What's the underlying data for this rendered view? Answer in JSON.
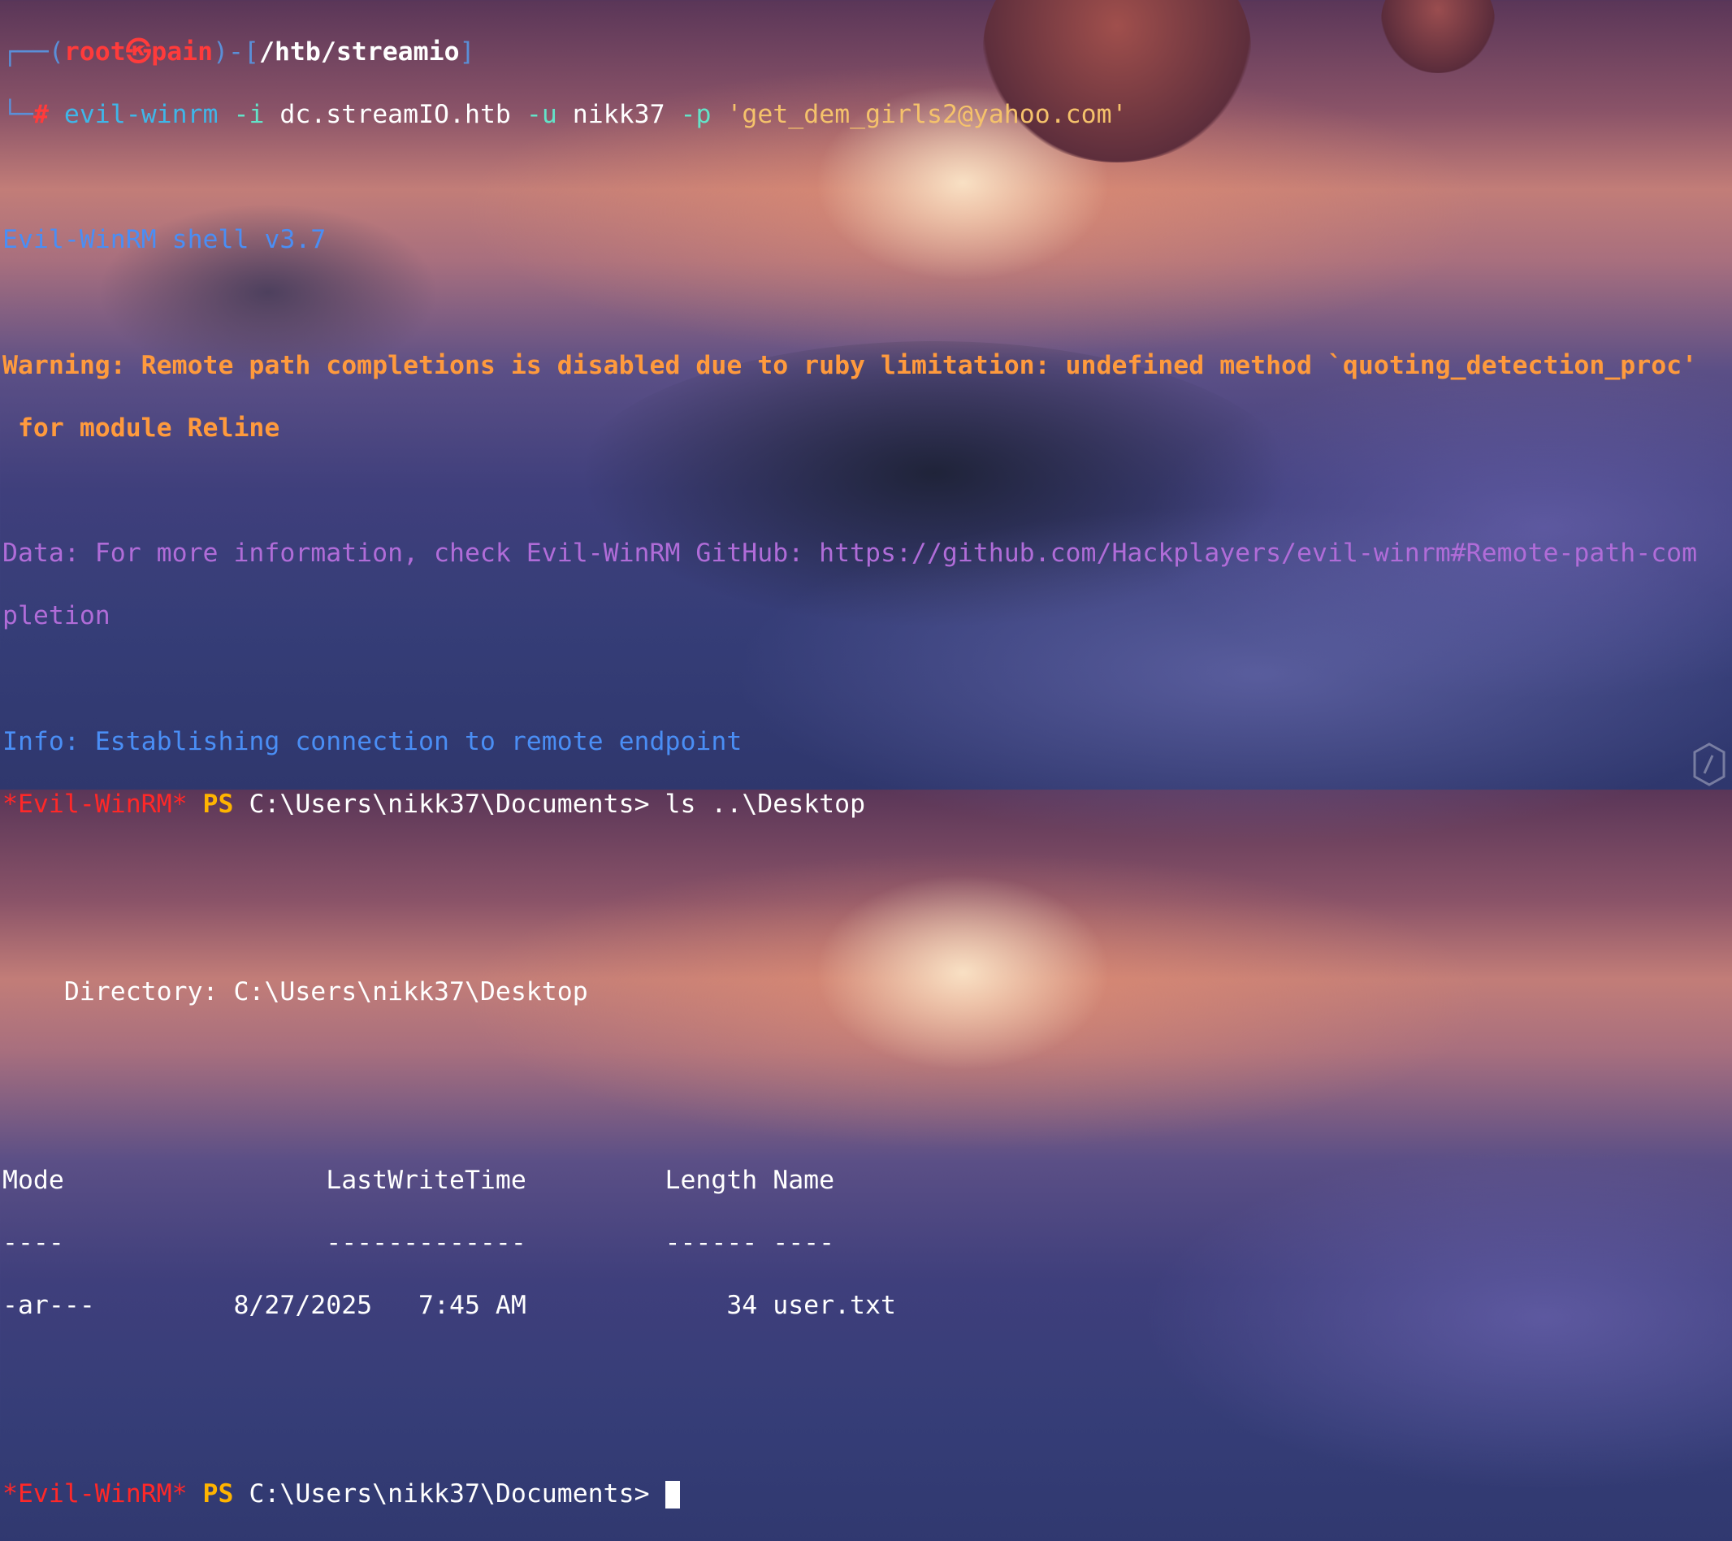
{
  "prompt1": {
    "corner_top": "┌──(",
    "user": "root",
    "at": "㉿",
    "host": "pain",
    "mid": ")-[",
    "path": "/htb/streamio",
    "end": "]",
    "corner_bottom": "└─",
    "hash": "#",
    "cmd": "evil-winrm",
    "flag_i": "-i",
    "host_arg": "dc.streamIO.htb",
    "flag_u": "-u",
    "user_arg": "nikk37",
    "flag_p": "-p",
    "pass_arg": "'get_dem_girls2@yahoo.com'"
  },
  "banner": "Evil-WinRM shell v3.7",
  "warning_line1": "Warning: Remote path completions is disabled due to ruby limitation: undefined method `quoting_detection_proc'",
  "warning_line2": " for module Reline",
  "data_line1": "Data: For more information, check Evil-WinRM GitHub: https://github.com/Hackplayers/evil-winrm#Remote-path-com",
  "data_line2": "pletion",
  "info_line": "Info: Establishing connection to remote endpoint",
  "ps_prompt": {
    "name": "*Evil-WinRM*",
    "ps": "PS",
    "cwd": "C:\\Users\\nikk37\\Documents>",
    "command": "ls ..\\Desktop"
  },
  "directory_line": "    Directory: C:\\Users\\nikk37\\Desktop",
  "table": {
    "header": "Mode                 LastWriteTime         Length Name",
    "rule": "----                 -------------         ------ ----",
    "rows": [
      "-ar---         8/27/2025   7:45 AM             34 user.txt"
    ]
  },
  "final_prompt": {
    "name": "*Evil-WinRM*",
    "ps": "PS",
    "cwd": "C:\\Users\\nikk37\\Documents>"
  },
  "colors": {
    "warning": "#ff9a3d",
    "info": "#4a8ef5",
    "data": "#b06cd8",
    "prompt_red": "#ff2828",
    "ps_yellow": "#ffb400"
  }
}
